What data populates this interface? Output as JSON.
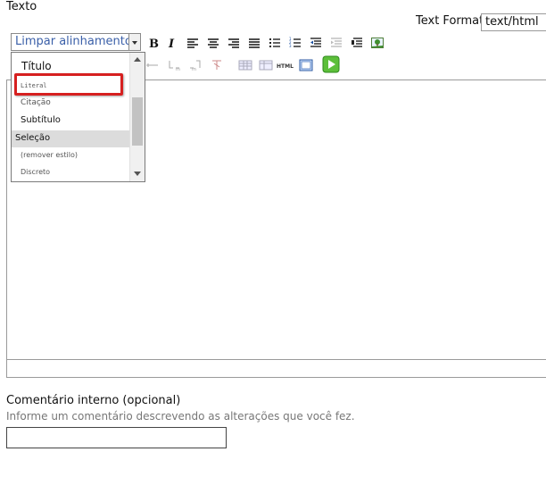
{
  "field": {
    "label": "Texto"
  },
  "text_format": {
    "label": "Text Format",
    "value": "text/html"
  },
  "style_combo": {
    "value": "Limpar alinhamento"
  },
  "toolbar": {
    "row1": [
      "bold-icon",
      "italic-icon",
      "align-left-icon",
      "align-center-icon",
      "align-right-icon",
      "align-justify-icon",
      "bulleted-list-icon",
      "numbered-list-icon",
      "outdent-icon",
      "indent-icon",
      "blockquote-icon",
      "image-icon"
    ],
    "row2": [
      "table-insert-row-icon",
      "table-insert-col-icon",
      "table-delete-icon",
      "table-props-icon",
      "table-cell-icon",
      "html-icon",
      "fullscreen-icon",
      "save-icon"
    ],
    "html_label": "HTML"
  },
  "dropdown": {
    "items": [
      {
        "label": "Título",
        "style": "heading"
      },
      {
        "label": "Literal",
        "style": "mono"
      },
      {
        "label": "Citação",
        "style": "small"
      },
      {
        "label": "Subtítulo",
        "style": "normal"
      },
      {
        "label": "Seleção",
        "style": "selected"
      },
      {
        "label": "(remover estilo)",
        "style": "small"
      },
      {
        "label": "Discreto",
        "style": "small"
      }
    ]
  },
  "comment": {
    "label": "Comentário interno (opcional)",
    "help": "Informe um comentário descrevendo as alterações que você fez.",
    "value": ""
  },
  "colors": {
    "highlight": "#d62020",
    "selected_bg": "#dcdcdc",
    "combo_text": "#3a5fa8"
  }
}
